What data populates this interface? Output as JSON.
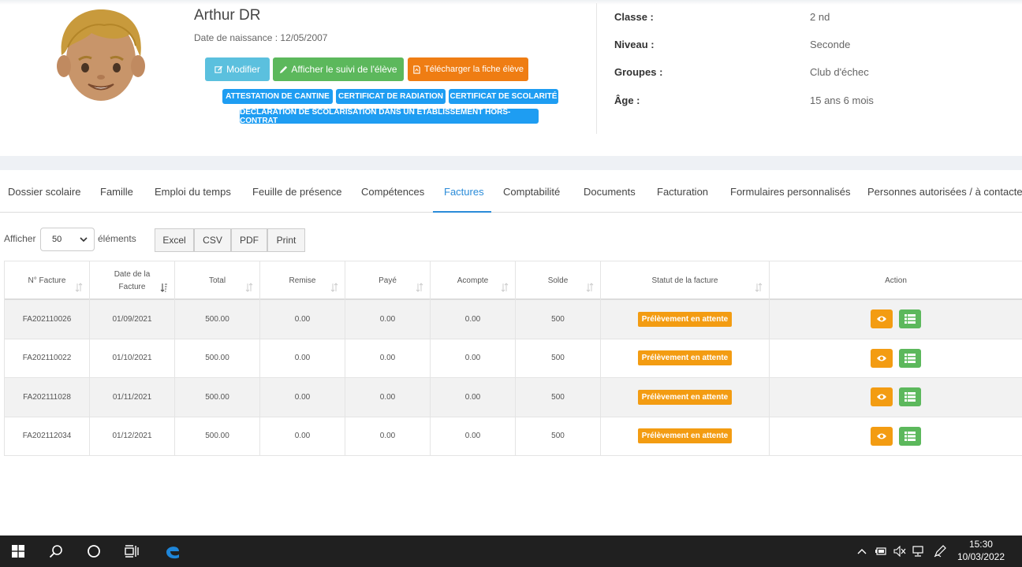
{
  "student": {
    "name": "Arthur DR",
    "birthdate_text": "Date de naissance : 12/05/2007"
  },
  "buttons": {
    "modify": "Modifier",
    "follow": "Afficher le suivi de l'élève",
    "download": "Télécharger la fiche élève"
  },
  "certificates": [
    "ATTESTATION DE CANTINE",
    "CERTIFICAT DE RADIATION",
    "CERTIFICAT DE SCOLARITÉ",
    "DÉCLARATION DE SCOLARISATION DANS UN ÉTABLISSEMENT HORS-CONTRAT"
  ],
  "info": [
    {
      "label": "Classe :",
      "value": "2 nd"
    },
    {
      "label": "Niveau :",
      "value": "Seconde"
    },
    {
      "label": "Groupes :",
      "value": "Club d'échec"
    },
    {
      "label": "Âge :",
      "value": "15 ans 6 mois"
    }
  ],
  "tabs": [
    "Dossier scolaire",
    "Famille",
    "Emploi du temps",
    "Feuille de présence",
    "Compétences",
    "Factures",
    "Comptabilité",
    "Documents",
    "Facturation",
    "Formulaires personnalisés",
    "Personnes autorisées / à contacter"
  ],
  "active_tab": "Factures",
  "controls": {
    "show_label": "Afficher",
    "page_size": "50",
    "elements_label": "éléments",
    "exports": [
      "Excel",
      "CSV",
      "PDF",
      "Print"
    ]
  },
  "table": {
    "headers": [
      "N° Facture",
      "Date de la Facture",
      "Total",
      "Remise",
      "Payé",
      "Acompte",
      "Solde",
      "Statut de la facture",
      "Action"
    ],
    "rows": [
      {
        "num": "FA202110026",
        "date": "01/09/2021",
        "total": "500.00",
        "remise": "0.00",
        "paye": "0.00",
        "acompte": "0.00",
        "solde": "500",
        "statut": "Prélèvement en attente"
      },
      {
        "num": "FA202110022",
        "date": "01/10/2021",
        "total": "500.00",
        "remise": "0.00",
        "paye": "0.00",
        "acompte": "0.00",
        "solde": "500",
        "statut": "Prélèvement en attente"
      },
      {
        "num": "FA202111028",
        "date": "01/11/2021",
        "total": "500.00",
        "remise": "0.00",
        "paye": "0.00",
        "acompte": "0.00",
        "solde": "500",
        "statut": "Prélèvement en attente"
      },
      {
        "num": "FA202112034",
        "date": "01/12/2021",
        "total": "500.00",
        "remise": "0.00",
        "paye": "0.00",
        "acompte": "0.00",
        "solde": "500",
        "statut": "Prélèvement en attente"
      }
    ]
  },
  "colors": {
    "tab_active": "#2a8bd8",
    "status_badge": "#f39c12",
    "btn_modify": "#5bc0de",
    "btn_follow": "#5cb85c",
    "btn_download": "#ef7d13",
    "certificate": "#1e9df2"
  },
  "taskbar": {
    "icons": [
      "windows-start-icon",
      "search-icon",
      "cortana-icon",
      "task-view-icon",
      "edge-icon"
    ],
    "tray_icons": [
      "chevron-up-icon",
      "battery-icon",
      "volume-muted-icon",
      "network-icon",
      "pen-icon"
    ],
    "time": "15:30",
    "date": "10/03/2022"
  }
}
